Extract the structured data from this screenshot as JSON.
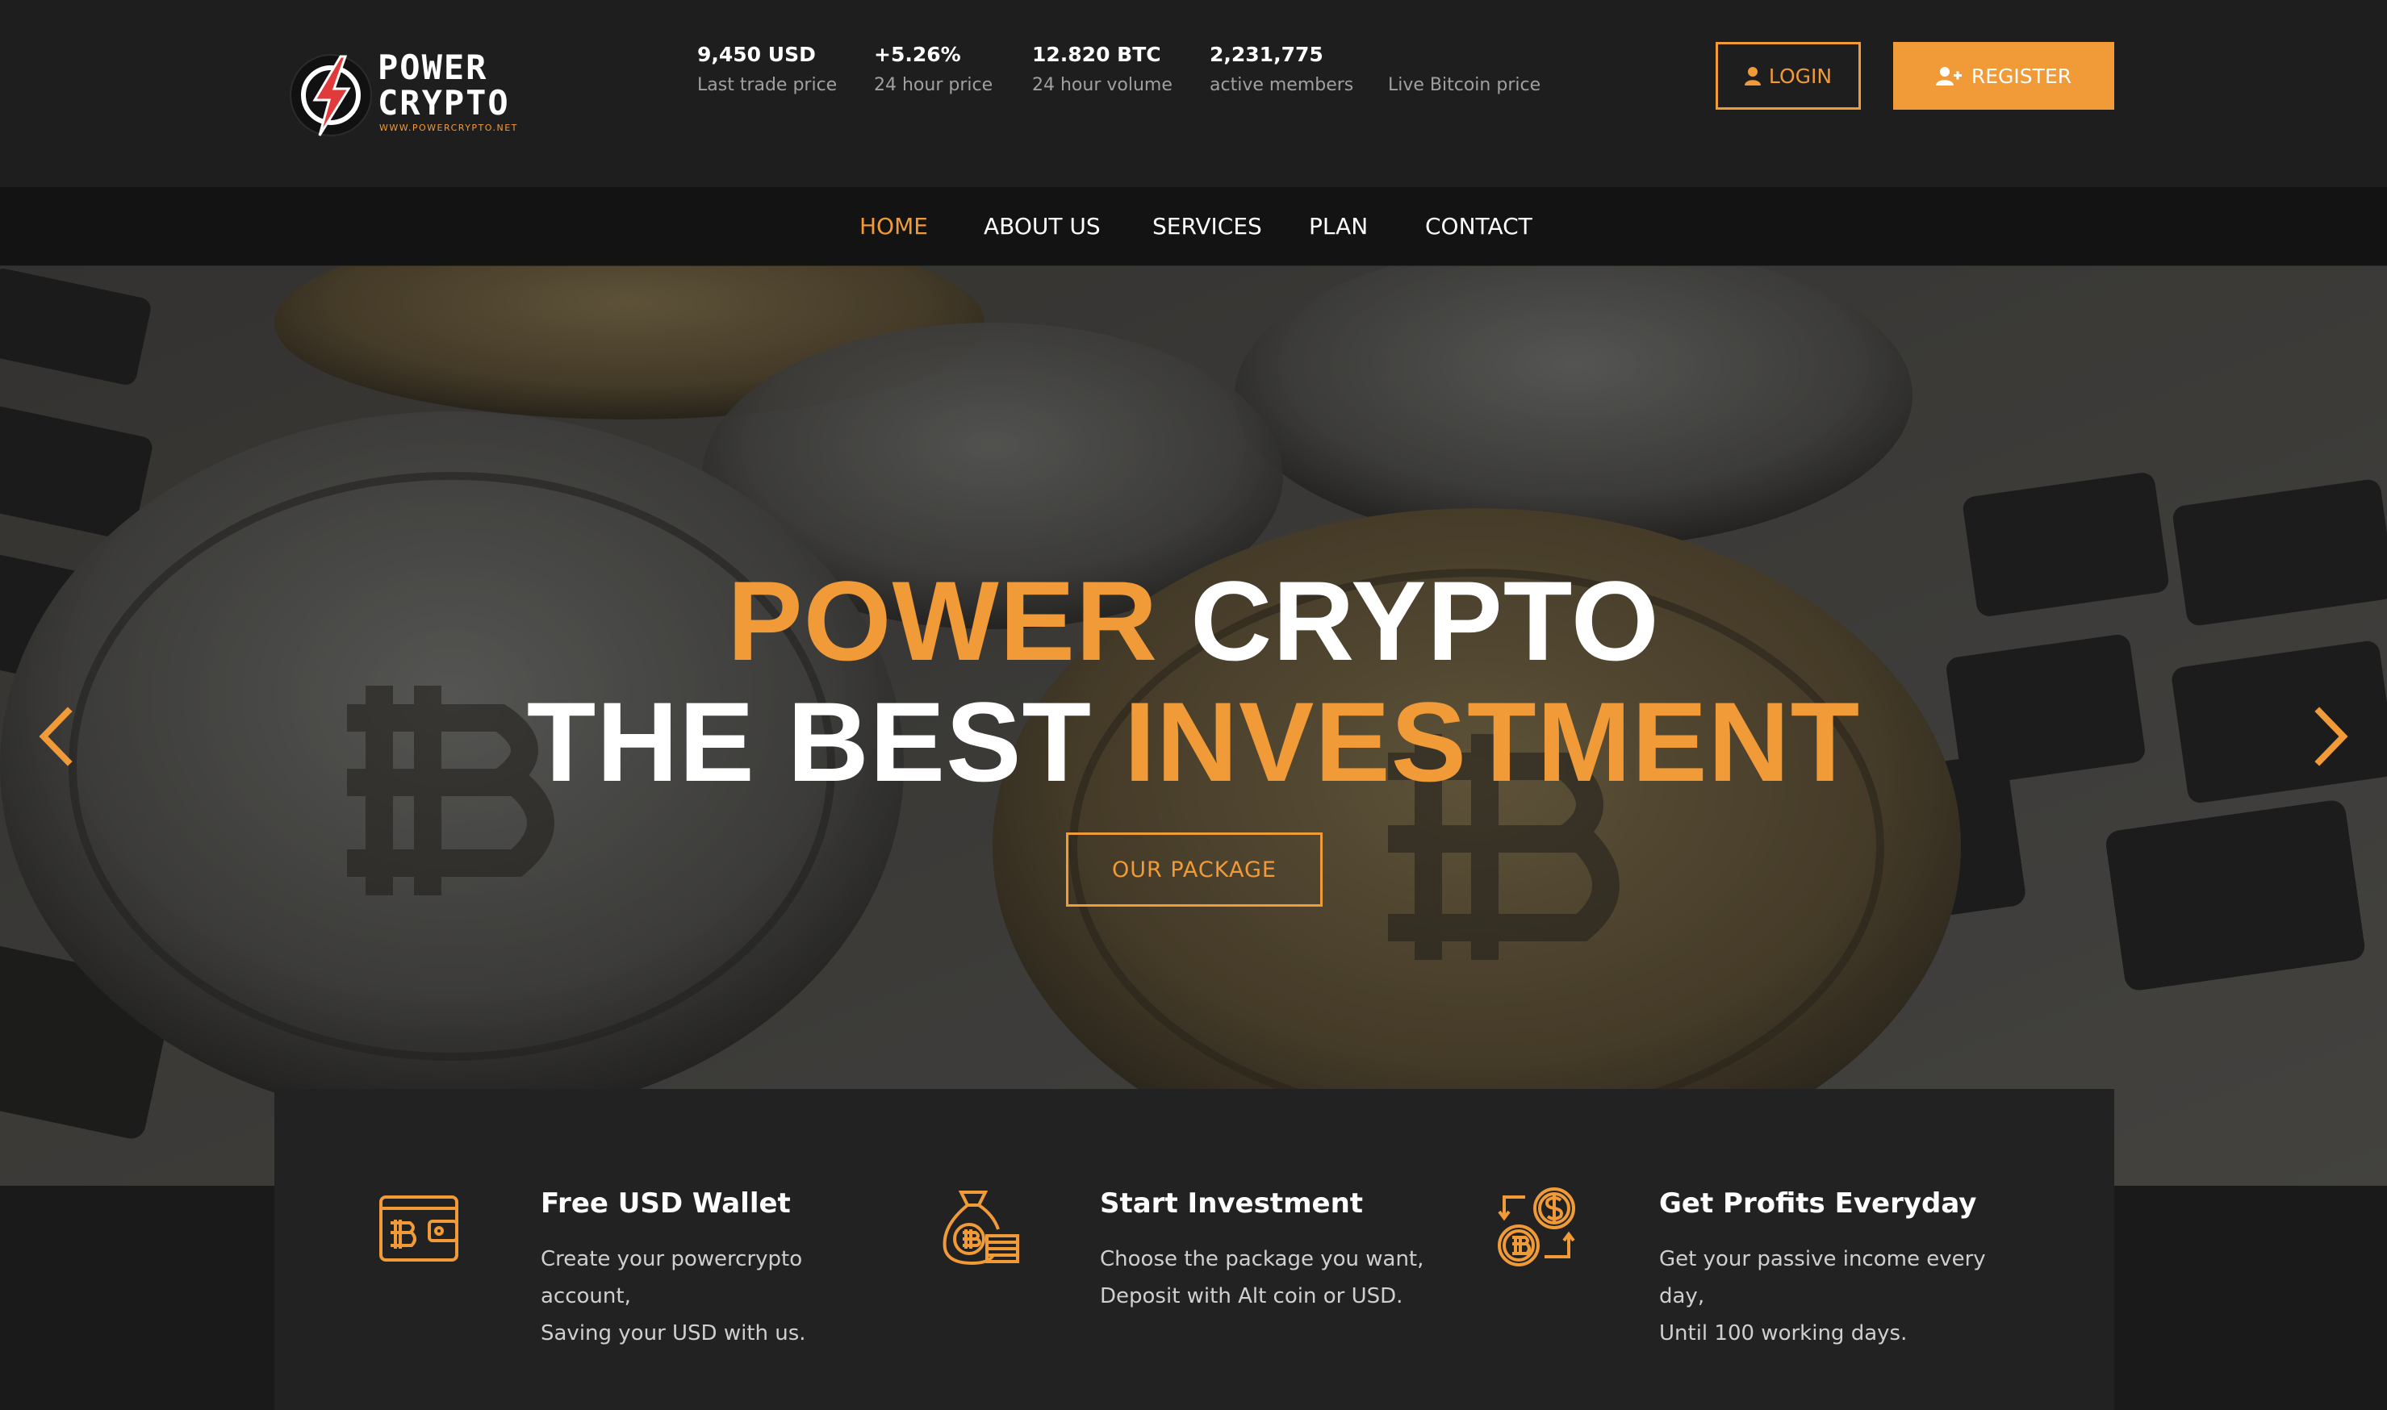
{
  "brand": {
    "name_line1": "POWER",
    "name_line2": "CRYPTO",
    "url": "WWW.POWERCRYPTO.NET",
    "accent_color": "#f19a38"
  },
  "stats": [
    {
      "value": "9,450 USD",
      "label": "Last trade price"
    },
    {
      "value": "+5.26%",
      "label": "24 hour price"
    },
    {
      "value": "12.820 BTC",
      "label": "24 hour volume"
    },
    {
      "value": "2,231,775",
      "label": "active members"
    },
    {
      "value": "",
      "label": "Live Bitcoin price"
    }
  ],
  "auth": {
    "login_label": "LOGIN",
    "login_icon": "user-icon",
    "register_label": "REGISTER",
    "register_icon": "user-plus-icon"
  },
  "nav": {
    "items": [
      "HOME",
      "ABOUT US",
      "SERVICES",
      "PLAN",
      "CONTACT"
    ],
    "active": "HOME"
  },
  "hero": {
    "line1_part1": "POWER",
    "line1_part2": "CRYPTO",
    "line2_part1": "THE BEST",
    "line2_part2": "INVESTMENT",
    "button_label": "OUR PACKAGE",
    "prev_icon": "chevron-left-icon",
    "next_icon": "chevron-right-icon"
  },
  "features": [
    {
      "icon": "bitcoin-wallet-icon",
      "title": "Free USD Wallet",
      "line1": "Create your powercrypto account,",
      "line2": "Saving your USD with us."
    },
    {
      "icon": "bitcoin-money-bag-icon",
      "title": "Start Investment",
      "line1": "Choose the package you want,",
      "line2": "Deposit with Alt coin or USD."
    },
    {
      "icon": "bitcoin-dollar-exchange-icon",
      "title": "Get Profits Everyday",
      "line1": "Get your passive income every day,",
      "line2": "Until 100 working days."
    }
  ]
}
